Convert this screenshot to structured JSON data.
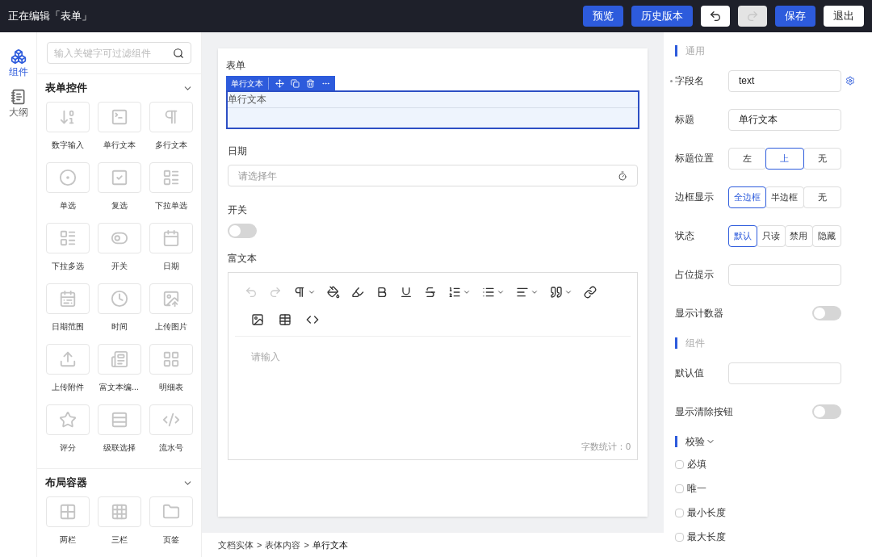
{
  "header": {
    "title": "正在编辑「表单」",
    "buttons": [
      {
        "kind": "primary",
        "label": "预览"
      },
      {
        "kind": "primary",
        "label": "历史版本"
      },
      {
        "kind": "undo",
        "disabled": false
      },
      {
        "kind": "redo",
        "disabled": true
      },
      {
        "kind": "primary",
        "label": "保存"
      },
      {
        "kind": "default",
        "label": "退出"
      }
    ]
  },
  "rail": [
    {
      "label": "组件",
      "selected": true
    },
    {
      "label": "大纲",
      "selected": false
    }
  ],
  "palette": {
    "search": {
      "placeholder": "输入关键字可过滤组件"
    },
    "groups": [
      {
        "title": "表单控件",
        "expanded": true,
        "items": [
          "数字输入",
          "单行文本",
          "多行文本",
          "单选",
          "复选",
          "下拉单选",
          "下拉多选",
          "开关",
          "日期",
          "日期范围",
          "时间",
          "上传图片",
          "上传附件",
          "富文本编...",
          "明细表",
          "评分",
          "级联选择",
          "流水号"
        ]
      },
      {
        "title": "布局容器",
        "expanded": true,
        "items": [
          "两栏",
          "三栏",
          "页签"
        ]
      }
    ]
  },
  "canvas": {
    "title": "表单",
    "field_toolbar": {
      "label": "单行文本"
    },
    "fields": [
      {
        "kind": "text",
        "label": "单行文本",
        "selected": true
      },
      {
        "kind": "date",
        "label": "日期",
        "placeholder": "请选择年",
        "selected": false
      },
      {
        "kind": "switch",
        "label": "开关",
        "on": false,
        "selected": false
      },
      {
        "kind": "richtext",
        "label": "富文本",
        "placeholder": "请输入",
        "counter": "字数统计：0",
        "selected": false
      }
    ],
    "breadcrumb": {
      "separator": ">",
      "items": [
        "文档实体",
        "表体内容",
        "单行文本"
      ]
    }
  },
  "properties": [
    {
      "title": "通用",
      "rows": [
        {
          "kind": "input",
          "label": "字段名",
          "value": "text",
          "required": true,
          "settings": true
        },
        {
          "kind": "input",
          "label": "标题",
          "value": "单行文本",
          "required": false,
          "settings": false
        },
        {
          "kind": "segmented",
          "label": "标题位置",
          "options": [
            {
              "label": "左",
              "selected": false
            },
            {
              "label": "上",
              "selected": true
            },
            {
              "label": "无",
              "selected": false
            }
          ]
        },
        {
          "kind": "segmented",
          "label": "边框显示",
          "options": [
            {
              "label": "全边框",
              "selected": true
            },
            {
              "label": "半边框",
              "selected": false
            },
            {
              "label": "无",
              "selected": false
            }
          ]
        },
        {
          "kind": "segmented",
          "label": "状态",
          "options": [
            {
              "label": "默认",
              "selected": true
            },
            {
              "label": "只读",
              "selected": false
            },
            {
              "label": "禁用",
              "selected": false
            },
            {
              "label": "隐藏",
              "selected": false
            }
          ]
        },
        {
          "kind": "input",
          "label": "占位提示",
          "value": "",
          "required": false,
          "settings": false
        },
        {
          "kind": "switch",
          "label": "显示计数器",
          "on": false
        }
      ]
    },
    {
      "title": "组件",
      "rows": [
        {
          "kind": "input",
          "label": "默认值",
          "value": "",
          "required": false,
          "settings": false
        },
        {
          "kind": "switch",
          "label": "显示清除按钮",
          "on": false
        }
      ]
    },
    {
      "title": "校验",
      "expandable": true,
      "rows": [
        {
          "kind": "checkbox",
          "label": "必填",
          "checked": false
        },
        {
          "kind": "checkbox",
          "label": "唯一",
          "checked": false
        },
        {
          "kind": "checkbox",
          "label": "最小长度",
          "checked": false
        },
        {
          "kind": "checkbox",
          "label": "最大长度",
          "checked": false
        }
      ]
    }
  ]
}
